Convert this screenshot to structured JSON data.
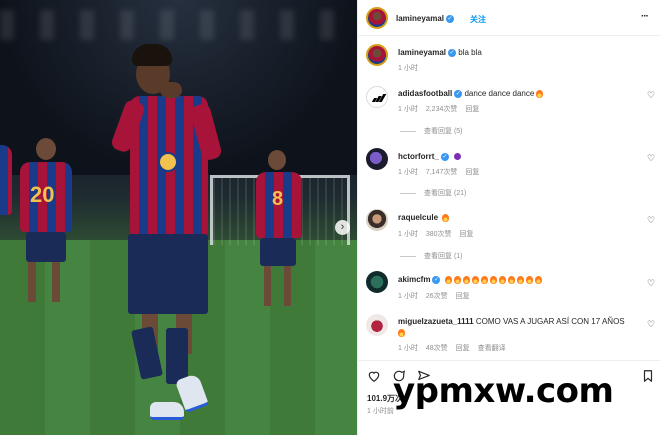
{
  "post": {
    "author": "lamineyamal",
    "follow_label": "关注",
    "caption_author": "lamineyamal",
    "caption_text": "bla bla",
    "caption_time": "1 小时"
  },
  "comments": [
    {
      "user": "adidasfootball",
      "verified": true,
      "text": "dance dance dance",
      "emoji": "fire",
      "time": "1 小时",
      "likes": "2,234次赞",
      "reply": "回复",
      "view_replies": "查看回复 (5)"
    },
    {
      "user": "hctorforrt_",
      "verified": true,
      "text": "",
      "emoji": "purple",
      "time": "1 小时",
      "likes": "7,147次赞",
      "reply": "回复",
      "view_replies": "查看回复 (21)"
    },
    {
      "user": "raquelcule",
      "verified": false,
      "text": "",
      "emoji": "fire",
      "time": "1 小时",
      "likes": "380次赞",
      "reply": "回复",
      "view_replies": "查看回复 (1)"
    },
    {
      "user": "akimcfm",
      "verified": true,
      "text": "",
      "emoji": "fire-row",
      "emoji_count": 11,
      "time": "1 小时",
      "likes": "26次赞",
      "reply": "回复",
      "view_replies": ""
    },
    {
      "user": "miguelzazueta_1111",
      "verified": false,
      "text": "COMO VAS A JUGAR ASÍ CON 17 AÑOS",
      "emoji": "fire",
      "time": "1 小时",
      "likes": "48次赞",
      "reply": "回复",
      "translate": "查看翻译",
      "view_replies": ""
    }
  ],
  "footer": {
    "likes": "101.9万次",
    "time": "1 小时前"
  },
  "photo": {
    "number_left": "20",
    "number_right": "8"
  },
  "watermark": "ypmxw.com",
  "colors": {
    "link_blue": "#0095f6",
    "verified_blue": "#3897f0",
    "muted": "#8e8e8e"
  },
  "icons": [
    "heart-icon",
    "comment-icon",
    "share-icon",
    "bookmark-icon",
    "more-icon",
    "verified-icon",
    "next-arrow-icon"
  ]
}
